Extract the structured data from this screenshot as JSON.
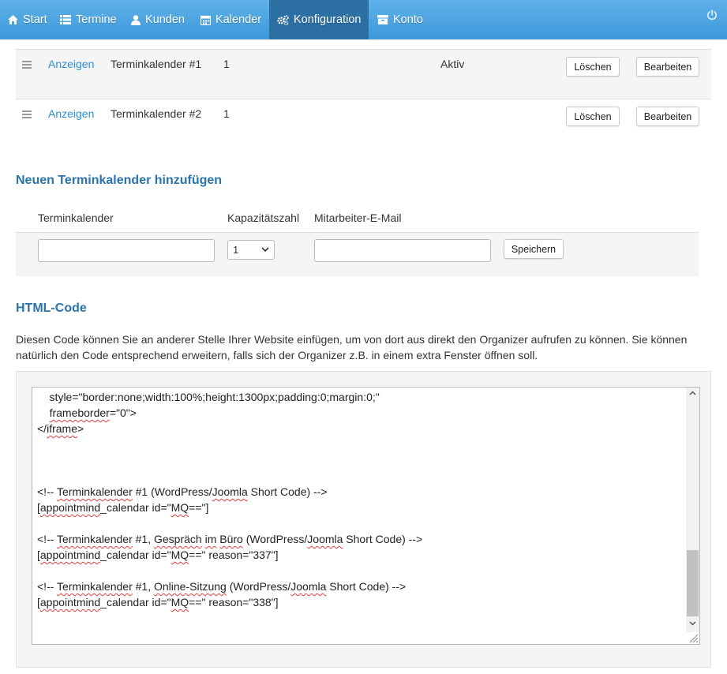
{
  "nav": {
    "items": [
      {
        "label": "Start",
        "icon": "home-icon"
      },
      {
        "label": "Termine",
        "icon": "list-icon"
      },
      {
        "label": "Kunden",
        "icon": "user-icon"
      },
      {
        "label": "Kalender",
        "icon": "calendar-icon"
      },
      {
        "label": "Konfiguration",
        "icon": "gears-icon"
      },
      {
        "label": "Konto",
        "icon": "archive-icon"
      }
    ],
    "active": "Konfiguration",
    "power_icon": "power-icon",
    "colors": {
      "bar": "#48a3e0",
      "active": "#2c6fa3"
    }
  },
  "calendars": [
    {
      "show_label": "Anzeigen",
      "name": "Terminkalender #1",
      "capacity": "1",
      "status": "Aktiv",
      "delete_label": "Löschen",
      "edit_label": "Bearbeiten"
    },
    {
      "show_label": "Anzeigen",
      "name": "Terminkalender #2",
      "capacity": "1",
      "status": "",
      "delete_label": "Löschen",
      "edit_label": "Bearbeiten"
    }
  ],
  "add_section": {
    "title": "Neuen Terminkalender hinzufügen",
    "col_calendar": "Terminkalender",
    "col_capacity": "Kapazitätszahl",
    "col_email": "Mitarbeiter-E-Mail",
    "calendar_value": "",
    "capacity_value": "1",
    "email_value": "",
    "save_label": "Speichern"
  },
  "html_section": {
    "title": "HTML-Code",
    "description": "Diesen Code können Sie an anderer Stelle Ihrer Website einfügen, um von dort aus direkt den Organizer aufrufen zu können. Sie können natürlich den Code entsprechend erweitern, falls sich der Organizer z.B. in einem extra Fenster öffnen soll.",
    "code_lines": [
      "    style=\"border:none;width:100%;height:1300px;padding:0;margin:0;\"",
      "    frameborder=\"0\">",
      "</iframe>",
      "",
      "",
      "",
      "<!-- Terminkalender #1 (WordPress/Joomla Short Code) -->",
      "[appointmind_calendar id=\"MQ==\"]",
      "",
      "<!-- Terminkalender #1, Gespräch im Büro (WordPress/Joomla Short Code) -->",
      "[appointmind_calendar id=\"MQ==\" reason=\"337\"]",
      "",
      "<!-- Terminkalender #1, Online-Sitzung (WordPress/Joomla Short Code) -->",
      "[appointmind_calendar id=\"MQ==\" reason=\"338\"]"
    ]
  }
}
